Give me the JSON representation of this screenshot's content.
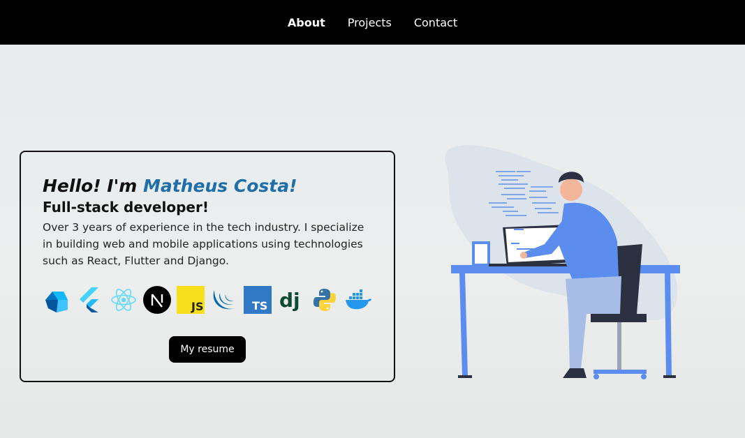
{
  "nav": {
    "about": "About",
    "projects": "Projects",
    "contact": "Contact"
  },
  "hero": {
    "greeting": "Hello! I'm ",
    "name": "Matheus Costa!",
    "role": "Full-stack developer!",
    "description": "Over 3 years of experience in the tech industry. I specialize in building web and mobile applications using technologies such as React, Flutter and Django.",
    "resume_label": "My resume",
    "tech_icons": [
      "dart-icon",
      "flutter-icon",
      "react-icon",
      "nextjs-icon",
      "javascript-icon",
      "jquery-icon",
      "typescript-icon",
      "django-icon",
      "python-icon",
      "docker-icon"
    ]
  },
  "colors": {
    "nav_bg": "#000000",
    "accent_name": "#1f6ea8",
    "illustration_blue": "#5b8def",
    "blob": "#dde3ea"
  }
}
